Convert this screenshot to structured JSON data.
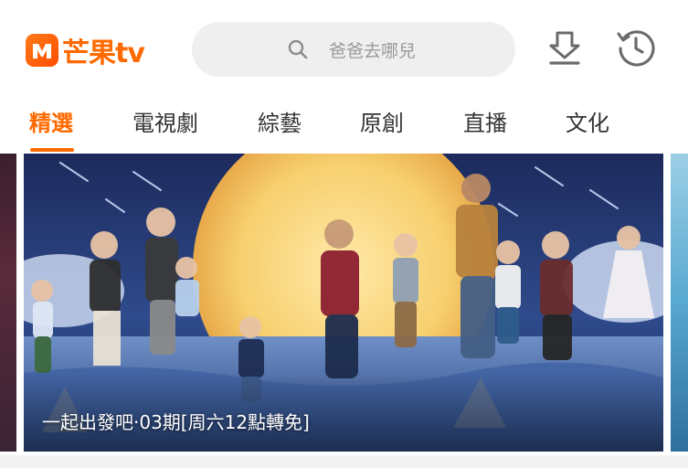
{
  "header": {
    "logo_text": "芒果tv",
    "search_placeholder": "爸爸去哪兒",
    "accent_color": "#ff6a00"
  },
  "tabs": [
    {
      "label": "精選",
      "active": true
    },
    {
      "label": "電視劇",
      "active": false
    },
    {
      "label": "綜藝",
      "active": false
    },
    {
      "label": "原創",
      "active": false
    },
    {
      "label": "直播",
      "active": false
    },
    {
      "label": "文化",
      "active": false
    }
  ],
  "banner": {
    "caption": "一起出發吧·03期[周六12點轉免]"
  },
  "icons": [
    "search-icon",
    "download-icon",
    "history-icon"
  ]
}
